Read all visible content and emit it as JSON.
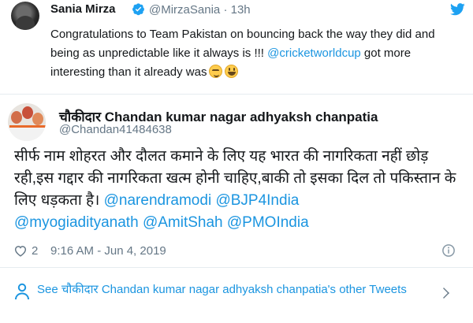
{
  "quoted_tweet": {
    "author_name": "Sania Mirza",
    "author_handle": "@MirzaSania",
    "age": "· 13h",
    "text_main": "Congratulations to Team Pakistan on bouncing back the way they did and being as unpredictable like it always is !!! ",
    "text_link": "@cricketworldcup",
    "text_tail": " got more interesting than it already was"
  },
  "tweet": {
    "author_name": "चौकीदार Chandan kumar nagar adhyaksh chanpatia",
    "author_handle": "@Chandan41484638",
    "text_main": "सीर्फ नाम शोहरत और दौलत कमाने के लिए यह भारत की नागरिकता नहीं छोड़ रही,इस गद्दार की नागरिकता खत्म होनी चाहिए,बाकी तो इसका दिल तो पकिस्तान के लिए धड़कता है। ",
    "mentions": [
      "@narendramodi",
      "@BJP4India",
      "@myogiadityanath",
      "@AmitShah",
      "@PMOIndia"
    ],
    "like_count": "2",
    "timestamp": "9:16 AM - Jun 4, 2019"
  },
  "footer": {
    "link_text": "See चौकीदार Chandan kumar nagar adhyaksh chanpatia's other Tweets"
  },
  "colors": {
    "link": "#1b95e0",
    "secondary": "#657786",
    "text": "#14171a",
    "divider": "#e6ecf0"
  }
}
